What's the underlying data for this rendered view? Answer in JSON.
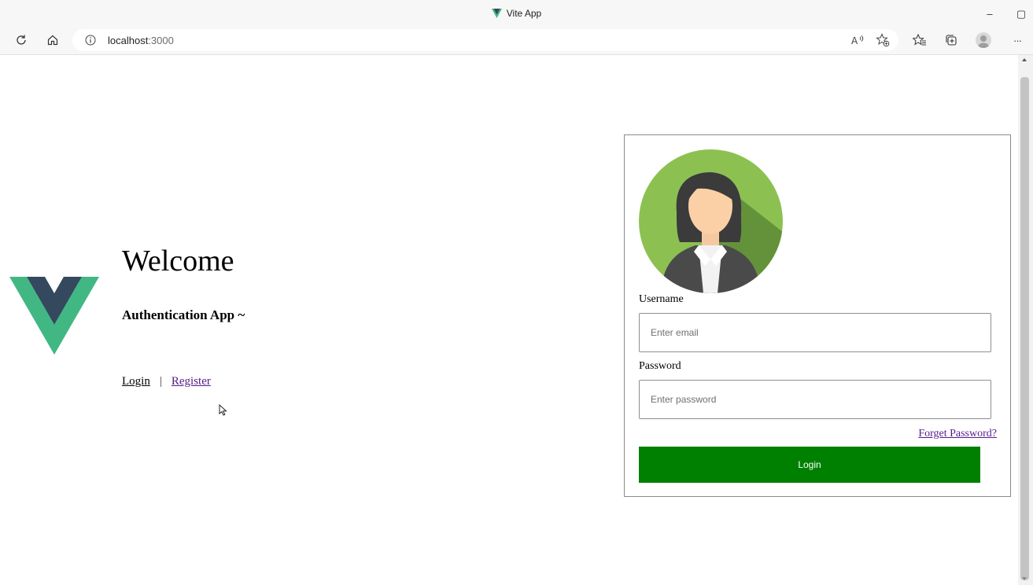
{
  "browser": {
    "window_title": "Vite App",
    "url_host": "localhost",
    "url_port": ":3000",
    "buttons": {
      "minimize": "–",
      "restore": "▢",
      "more": "···"
    }
  },
  "hero": {
    "title": "Welcome",
    "subtitle": "Authentication App ~",
    "login_link": "Login",
    "separator": "|",
    "register_link": "Register"
  },
  "login_form": {
    "username_label": "Username",
    "username_placeholder": "Enter email",
    "password_label": "Password",
    "password_placeholder": "Enter password",
    "forget_link": "Forget Password?",
    "submit_label": "Login"
  },
  "colors": {
    "vue_green": "#41b883",
    "vue_dark": "#34495e",
    "button_green": "#008000",
    "visited_link": "#551a8b"
  },
  "icons": [
    "vite-logo-icon",
    "refresh-icon",
    "home-icon",
    "info-icon",
    "read-aloud-icon",
    "add-favorite-icon",
    "favorites-icon",
    "collections-icon",
    "profile-icon",
    "more-icon",
    "vue-logo-icon",
    "user-avatar-icon",
    "mouse-cursor-icon"
  ]
}
